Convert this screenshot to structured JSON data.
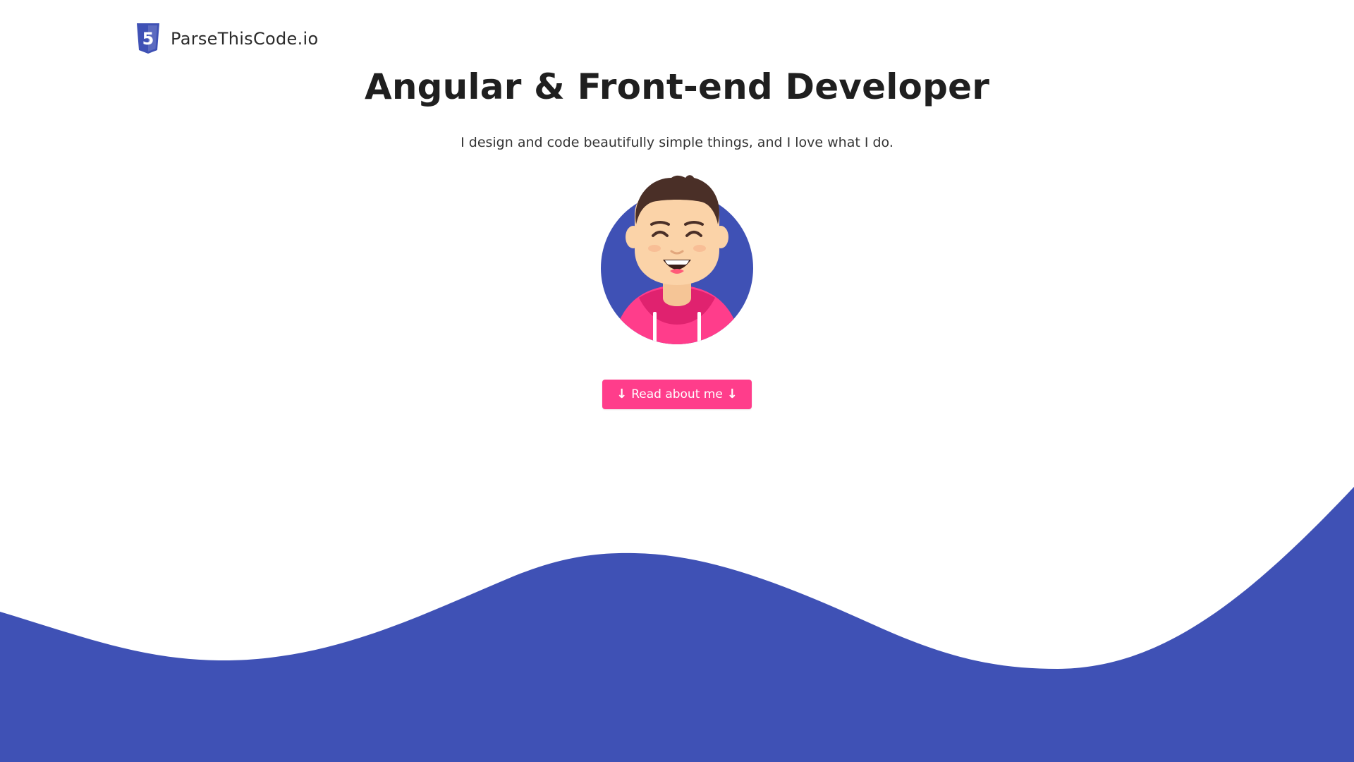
{
  "brand": {
    "name": "ParseThisCode.io",
    "icon": "html5-icon",
    "icon_glyph": "5"
  },
  "hero": {
    "title": "Angular & Front-end Developer",
    "subtitle": "I design and code beautifully simple things, and I love what I do.",
    "cta_label": "Read about me",
    "cta_icon": "arrow-down-icon",
    "cta_arrow": "↓"
  },
  "avatar": {
    "icon": "developer-avatar-illustration"
  },
  "colors": {
    "accent": "#3f51b5",
    "button": "#ff3d8b",
    "hoodie": "#ff3d8b",
    "skin": "#fbd3a8",
    "hair": "#4a2f27",
    "text": "#1f1f1f",
    "background": "#ffffff"
  }
}
